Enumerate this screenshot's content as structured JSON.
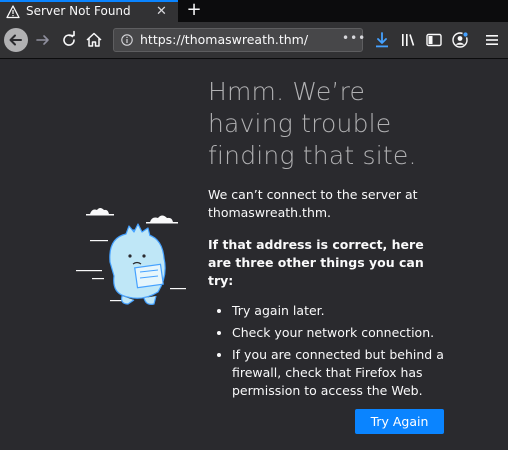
{
  "tab": {
    "title": "Server Not Found",
    "close_glyph": "✕",
    "favicon": "warning-icon"
  },
  "newtab_glyph": "+",
  "toolbar": {
    "url": "https://thomaswreath.thm/",
    "page_actions_glyph": "•••"
  },
  "error": {
    "heading": "Hmm. We’re having trouble finding that site.",
    "description": "We can’t connect to the server at thomaswreath.thm.",
    "subheading": "If that address is correct, here are three other things you can try:",
    "tips": [
      "Try again later.",
      "Check your network connection.",
      "If you are connected but behind a firewall, check that Firefox has permission to access the Web."
    ],
    "try_again_label": "Try Again"
  },
  "colors": {
    "accent": "#0a84ff",
    "background": "#2a2a2e",
    "toolbar": "#323234"
  }
}
